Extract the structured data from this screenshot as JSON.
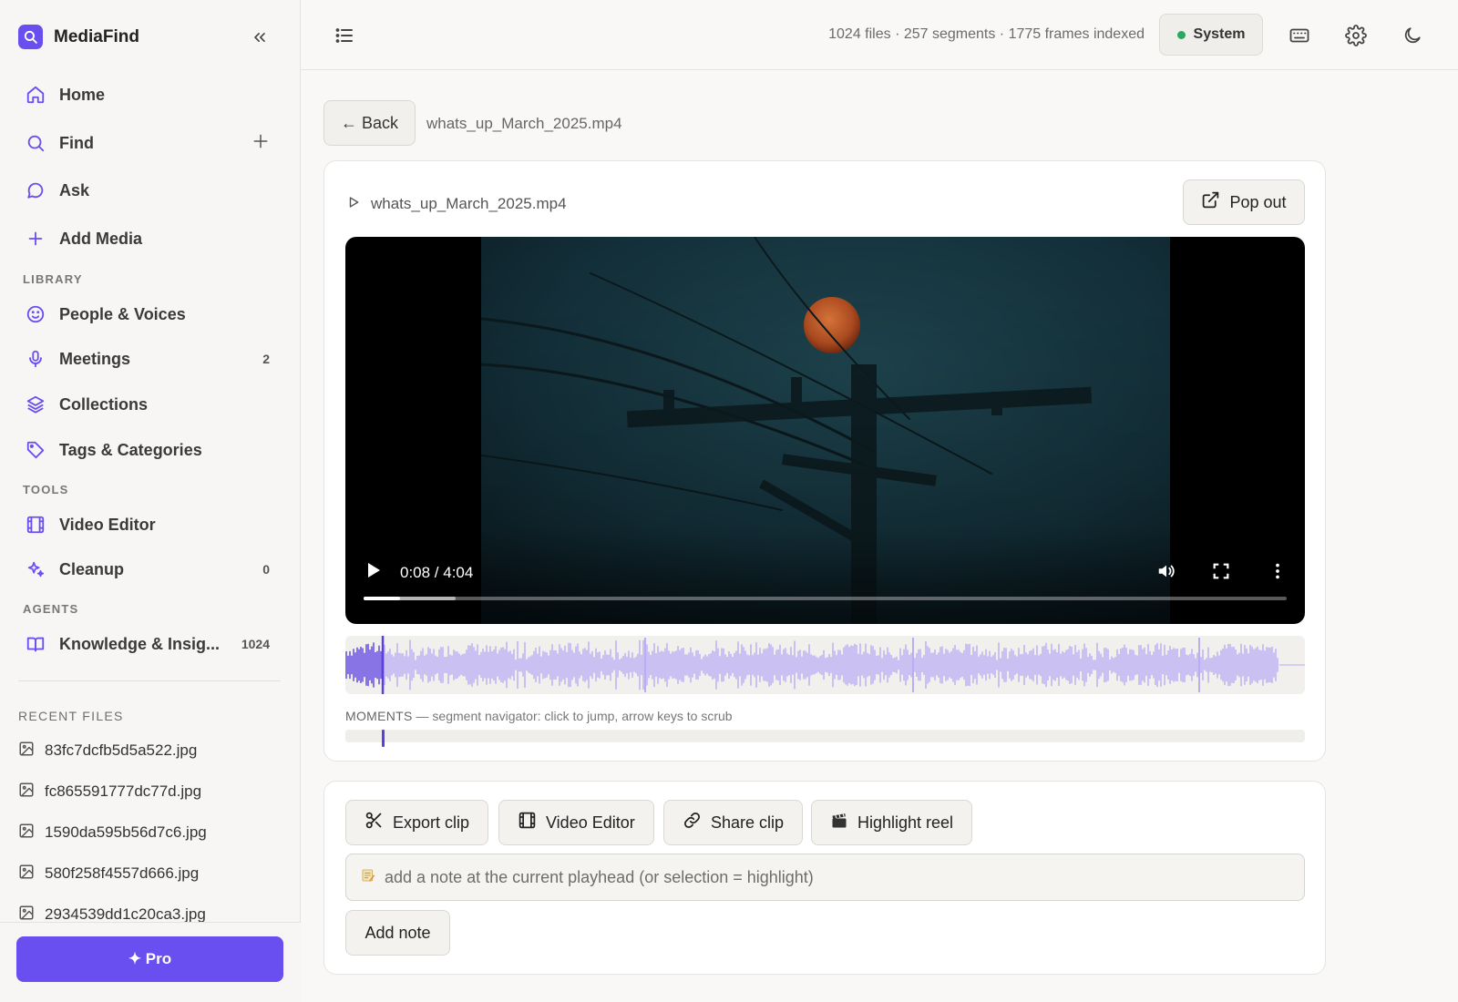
{
  "app": {
    "name": "MediaFind",
    "brand_color": "#6a4ff0"
  },
  "sidebar": {
    "nav": [
      {
        "label": "Home",
        "icon": "home-icon"
      },
      {
        "label": "Find",
        "icon": "search-icon",
        "action_icon": "plus-icon"
      },
      {
        "label": "Ask",
        "icon": "chat-bubble-icon"
      },
      {
        "label": "Add Media",
        "icon": "plus-icon"
      }
    ],
    "library_label": "LIBRARY",
    "library": [
      {
        "label": "People & Voices",
        "icon": "smiley-icon",
        "count": ""
      },
      {
        "label": "Meetings",
        "icon": "microphone-icon",
        "count": "2"
      },
      {
        "label": "Collections",
        "icon": "layers-icon",
        "count": ""
      },
      {
        "label": "Tags & Categories",
        "icon": "tag-icon",
        "count": ""
      }
    ],
    "tools_label": "TOOLS",
    "tools": [
      {
        "label": "Video Editor",
        "icon": "film-icon",
        "count": ""
      },
      {
        "label": "Cleanup",
        "icon": "sparkle-icon",
        "count": "0"
      }
    ],
    "agents_label": "AGENTS",
    "agents": [
      {
        "label": "Knowledge & Insig...",
        "icon": "book-icon",
        "count": "1024"
      }
    ],
    "recent_label": "RECENT FILES",
    "recent_files": [
      "83fc7dcfb5d5a522.jpg",
      "fc865591777dc77d.jpg",
      "1590da595b56d7c6.jpg",
      "580f258f4557d666.jpg",
      "2934539dd1c20ca3.jpg"
    ],
    "pro_label": "✦ Pro"
  },
  "topbar": {
    "stats": "1024 files · 257 segments · 1775 frames indexed",
    "system_label": "System",
    "system_status_color": "#2ea760"
  },
  "page": {
    "back_label": "← Back",
    "breadcrumb_file": "whats_up_March_2025.mp4"
  },
  "player": {
    "title": "whats_up_March_2025.mp4",
    "popout_label": "Pop out",
    "time": "0:08 / 4:04",
    "played_fraction": 0.039,
    "buffered_fraction": 0.1,
    "moments_heading": "MOMENTS",
    "moments_hint": " — segment navigator: click to jump, arrow keys to scrub",
    "waveform_color": "#b9adf5",
    "waveform_played_color": "#5b3fe0"
  },
  "actions": {
    "buttons": [
      {
        "label": "Export clip",
        "icon": "scissors-icon"
      },
      {
        "label": "Video Editor",
        "icon": "film-icon"
      },
      {
        "label": "Share clip",
        "icon": "link-icon"
      },
      {
        "label": "Highlight reel",
        "icon": "clapperboard-icon"
      }
    ],
    "note_placeholder": "add a note at the current playhead (or selection = highlight)",
    "note_icon": "memo-icon",
    "add_note_label": "Add note"
  }
}
